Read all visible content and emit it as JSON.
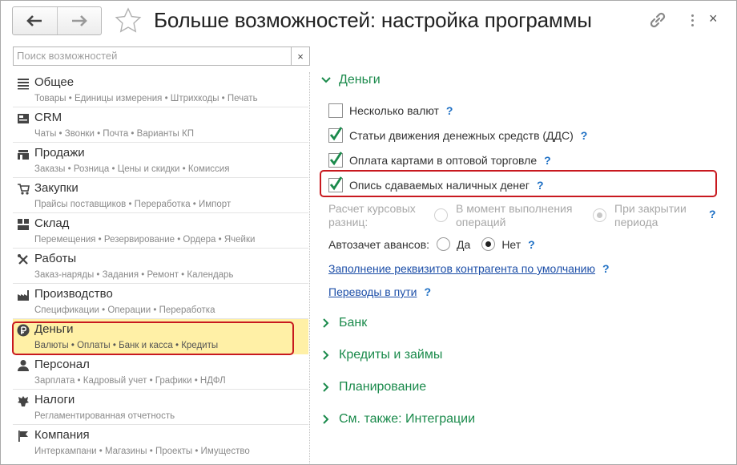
{
  "header": {
    "title": "Больше возможностей: настройка программы",
    "back_icon": "arrow-left-icon",
    "forward_icon": "arrow-right-icon",
    "favorite_icon": "star-icon",
    "link_icon": "link-icon",
    "more_icon": "more-vertical-icon",
    "close_glyph": "×"
  },
  "search": {
    "placeholder": "Поиск возможностей",
    "value": "",
    "clear_glyph": "×"
  },
  "sections": [
    {
      "name": "Общее",
      "sub": "Товары • Единицы измерения • Штрихкоды • Печать",
      "icon": "list-icon"
    },
    {
      "name": "CRM",
      "sub": "Чаты • Звонки • Почта • Варианты КП",
      "icon": "crm-icon"
    },
    {
      "name": "Продажи",
      "sub": "Заказы • Розница • Цены и скидки • Комиссия",
      "icon": "sales-icon"
    },
    {
      "name": "Закупки",
      "sub": "Прайсы поставщиков • Переработка • Импорт",
      "icon": "cart-icon"
    },
    {
      "name": "Склад",
      "sub": "Перемещения • Резервирование • Ордера • Ячейки",
      "icon": "warehouse-icon"
    },
    {
      "name": "Работы",
      "sub": "Заказ-наряды • Задания • Ремонт • Календарь",
      "icon": "tools-icon"
    },
    {
      "name": "Производство",
      "sub": "Спецификации • Операции • Переработка",
      "icon": "factory-icon"
    },
    {
      "name": "Деньги",
      "sub": "Валюты • Оплаты • Банк и касса • Кредиты",
      "icon": "ruble-icon"
    },
    {
      "name": "Персонал",
      "sub": "Зарплата • Кадровый учет • Графики • НДФЛ",
      "icon": "person-icon"
    },
    {
      "name": "Налоги",
      "sub": "Регламентированная отчетность",
      "icon": "emblem-icon"
    },
    {
      "name": "Компания",
      "sub": "Интеркампани • Магазины • Проекты • Имущество",
      "icon": "flag-icon"
    }
  ],
  "selected_section": "Деньги",
  "panel": {
    "group_money": "Деньги",
    "options": [
      {
        "label": "Несколько валют",
        "checked": false
      },
      {
        "label": "Статьи движения денежных средств (ДДС)",
        "checked": true
      },
      {
        "label": "Оплата картами в оптовой торговле",
        "checked": true
      },
      {
        "label": "Опись сдаваемых наличных денег",
        "checked": true
      }
    ],
    "help": "?",
    "rate_diff": {
      "label_line1": "Расчет курсовых",
      "label_line2": "разниц:",
      "opt1_line1": "В момент выполнения",
      "opt1_line2": "операций",
      "opt2_line1": "При закрытии",
      "opt2_line2": "периода",
      "selected": "При закрытии периода"
    },
    "advance": {
      "label": "Автозачет авансов:",
      "yes": "Да",
      "no": "Нет",
      "selected": "Нет"
    },
    "link_requisites": "Заполнение реквизитов контрагента по умолчанию",
    "link_transfers": "Переводы в пути",
    "groups": [
      "Банк",
      "Кредиты и займы",
      "Планирование",
      "См. также: Интеграции"
    ]
  },
  "colors": {
    "accent_green": "#1a8a4b",
    "highlight_red": "#c8191f",
    "selected_bg": "#fff0a6",
    "link_blue": "#1d4fa8",
    "help_blue": "#1d6fc4"
  }
}
